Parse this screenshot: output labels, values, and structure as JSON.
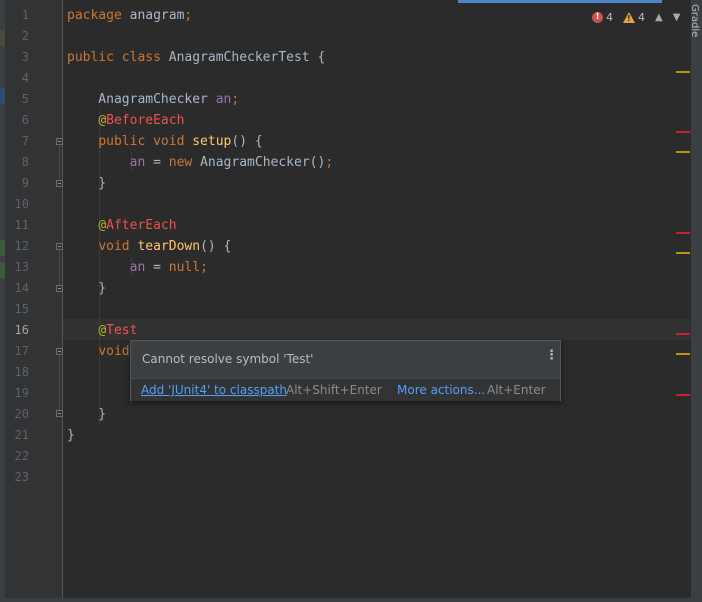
{
  "gutter": {
    "line_numbers": [
      "1",
      "2",
      "3",
      "4",
      "5",
      "6",
      "7",
      "8",
      "9",
      "10",
      "11",
      "12",
      "13",
      "14",
      "15",
      "16",
      "17",
      "18",
      "19",
      "20",
      "21",
      "22",
      "23"
    ],
    "current_line": "16"
  },
  "code": {
    "lines": [
      [
        {
          "t": "package ",
          "c": "kw"
        },
        {
          "t": "anagram",
          "c": ""
        },
        {
          "t": ";",
          "c": "kw"
        }
      ],
      [],
      [
        {
          "t": "public class ",
          "c": "kw"
        },
        {
          "t": "AnagramCheckerTest {",
          "c": ""
        }
      ],
      [],
      [
        {
          "t": "    AnagramChecker ",
          "c": ""
        },
        {
          "t": "an",
          "c": "field"
        },
        {
          "t": ";",
          "c": "kw"
        }
      ],
      [
        {
          "t": "    ",
          "c": ""
        },
        {
          "t": "@",
          "c": "ann"
        },
        {
          "t": "BeforeEach",
          "c": "annred"
        }
      ],
      [
        {
          "t": "    ",
          "c": ""
        },
        {
          "t": "public void ",
          "c": "kw"
        },
        {
          "t": "setup",
          "c": "fn"
        },
        {
          "t": "() {",
          "c": ""
        }
      ],
      [
        {
          "t": "        ",
          "c": ""
        },
        {
          "t": "an",
          "c": "field"
        },
        {
          "t": " = ",
          "c": ""
        },
        {
          "t": "new ",
          "c": "kw"
        },
        {
          "t": "AnagramChecker()",
          "c": ""
        },
        {
          "t": ";",
          "c": "kw"
        }
      ],
      [
        {
          "t": "    }",
          "c": ""
        }
      ],
      [],
      [
        {
          "t": "    ",
          "c": ""
        },
        {
          "t": "@",
          "c": "ann"
        },
        {
          "t": "AfterEach",
          "c": "annred"
        }
      ],
      [
        {
          "t": "    ",
          "c": ""
        },
        {
          "t": "void ",
          "c": "kw"
        },
        {
          "t": "tearDown",
          "c": "fn"
        },
        {
          "t": "() {",
          "c": ""
        }
      ],
      [
        {
          "t": "        ",
          "c": ""
        },
        {
          "t": "an",
          "c": "field"
        },
        {
          "t": " = ",
          "c": ""
        },
        {
          "t": "null",
          "c": "kw"
        },
        {
          "t": ";",
          "c": "kw"
        }
      ],
      [
        {
          "t": "    }",
          "c": ""
        }
      ],
      [],
      [
        {
          "t": "    ",
          "c": ""
        },
        {
          "t": "@",
          "c": "ann"
        },
        {
          "t": "Test",
          "c": "annred"
        }
      ],
      [
        {
          "t": "    ",
          "c": ""
        },
        {
          "t": "void",
          "c": "kw"
        }
      ],
      [],
      [],
      [
        {
          "t": "    }",
          "c": ""
        }
      ],
      [
        {
          "t": "}",
          "c": ""
        }
      ],
      [],
      []
    ]
  },
  "inspection_widget": {
    "error_count": "4",
    "warning_count": "4",
    "error_icon": "error-circle-icon",
    "warning_icon": "warning-triangle-icon"
  },
  "right_tool_window": {
    "label": "Gradle"
  },
  "popup": {
    "message": "Cannot resolve symbol 'Test'",
    "primary_action": "Add 'JUnit4' to classpath",
    "primary_shortcut": "Alt+Shift+Enter",
    "more_action": "More actions...",
    "more_shortcut": "Alt+Enter",
    "menu_icon": "vertical-dots-icon"
  },
  "colors": {
    "background": "#2b2b2b",
    "keyword": "#cc7832",
    "annotation_error": "#f0524f",
    "field": "#9876aa",
    "method": "#ffc66d",
    "link": "#589df6",
    "error_stripe": "#c7222d",
    "warning_stripe": "#be9117"
  }
}
